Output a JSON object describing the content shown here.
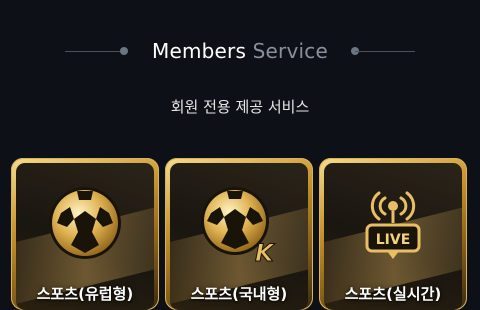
{
  "header": {
    "title_part1": "Members",
    "title_part2": "Service",
    "subtitle": "회원 전용 제공 서비스"
  },
  "cards": [
    {
      "label": "스포츠(유럽형)",
      "icon": "soccer-ball-icon"
    },
    {
      "label": "스포츠(국내형)",
      "icon": "soccer-ball-k-icon",
      "badge": "K"
    },
    {
      "label": "스포츠(실시간)",
      "icon": "live-broadcast-icon",
      "badge": "LIVE"
    }
  ],
  "colors": {
    "background": "#0d1117",
    "gold": "#c9962f",
    "gold_light": "#f5dc8c",
    "muted_text": "#8a909b"
  }
}
